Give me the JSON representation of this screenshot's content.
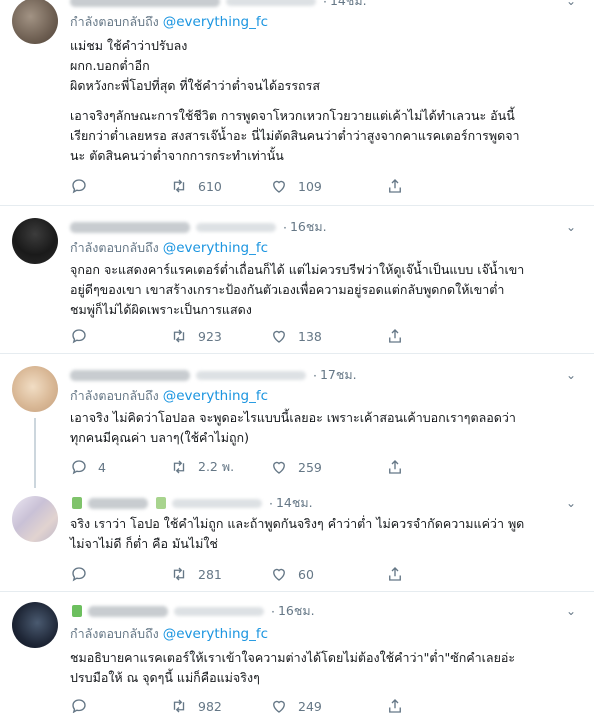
{
  "reply_prefix": "กำลังตอบกลับถึง",
  "tweets": [
    {
      "time": "14ชม.",
      "mention": "@everything_fc",
      "lines": [
        "แม่ชม ใช้คำว่าปรับลง",
        "ผกก.บอกต่ำอีก",
        "ผิดหวังกะพี่โอปที่สุด ที่ใช้คำว่าต่ำจนได้อรรถรส",
        "",
        "เอาจริงๆลักษณะการใช้ชีวิต การพูดจาโหวกเหวกโวยวายแต่เค้าไม่ได้ทำเลวนะ อันนี้",
        "เรียกว่าต่ำเลยหรอ สงสารเจ๊น้ำอะ นี่ไม่ตัดสินคนว่าต่ำว่าสูงจากคาแรคเตอร์การพูดจา",
        "นะ ตัดสินคนว่าต่ำจากการกระทำเท่านั้น"
      ],
      "replies": "",
      "retweets": "610",
      "likes": "109"
    },
    {
      "time": "16ชม.",
      "mention": "@everything_fc",
      "lines": [
        "จุกอก จะแสดงคาร์แรคเตอร์ต่ำเถื่อนก็ได้ แต่ไม่ควรบรีฟว่าให้ดูเจ๊น้ำเป็นแบบ เจ๊น้ำเขา",
        "อยู่ดีๆของเขา เขาสร้างเกราะป้องกันตัวเองเพื่อความอยู่รอดแต่กลับพูดกดให้เขาต่ำ",
        "ชมพู่ก็ไม่ได้ผิดเพราะเป็นการแสดง"
      ],
      "replies": "",
      "retweets": "923",
      "likes": "138"
    },
    {
      "time": "17ชม.",
      "mention": "@everything_fc",
      "lines": [
        "เอาจริง ไม่คิดว่าโอปอล จะพูดอะไรแบบนี้เลยอะ เพราะเค้าสอนเค้าบอกเราๆตลอดว่า",
        "ทุกคนมีคุณค่า บลาๆ(ใช้คำไม่ถูก)"
      ],
      "replies": "4",
      "retweets": "2.2 พ.",
      "likes": "259"
    },
    {
      "time": "14ชม.",
      "mention": "",
      "lines": [
        "จริง เราว่า โอปอ ใช้คำไม่ถูก และถ้าพูดกันจริงๆ คำว่าต่ำ ไม่ควรจำกัดความแค่ว่า พูด",
        "ไม่จาไม่ดี ก็ต่ำ คือ มันไม่ใช่"
      ],
      "replies": "",
      "retweets": "281",
      "likes": "60"
    },
    {
      "time": "16ชม.",
      "mention": "@everything_fc",
      "lines": [
        "ชมอธิบายคาแรคเตอร์ให้เราเข้าใจความต่างได้โดยไม่ต้องใช้คำว่า\"ต่ำ\"ซักคำเลยอ่ะ",
        "ปรบมือให้ ณ จุดๆนี้ แม่ก็คือแม่จริงๆ"
      ],
      "replies": "",
      "retweets": "982",
      "likes": "249"
    }
  ],
  "colors": {
    "accent": "#1b95e0",
    "muted": "#657786",
    "divider": "#e6ecf0"
  },
  "icons": [
    "reply-icon",
    "retweet-icon",
    "like-icon",
    "share-icon",
    "chevron-down-icon"
  ]
}
